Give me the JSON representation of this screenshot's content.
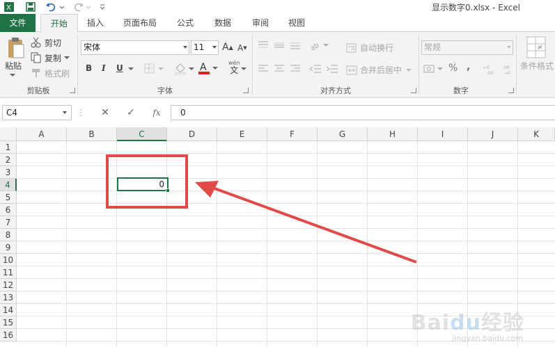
{
  "titlebar": {
    "title": "显示数字0.xlsx - Excel"
  },
  "tabs": [
    {
      "label": "文件"
    },
    {
      "label": "开始"
    },
    {
      "label": "插入"
    },
    {
      "label": "页面布局"
    },
    {
      "label": "公式"
    },
    {
      "label": "数据"
    },
    {
      "label": "审阅"
    },
    {
      "label": "视图"
    }
  ],
  "clipboard": {
    "paste": "粘贴",
    "cut": "剪切",
    "copy": "复制",
    "format_painter": "格式刷",
    "group": "剪贴板"
  },
  "font": {
    "name": "宋体",
    "size": "11",
    "bold": "B",
    "italic": "I",
    "underline": "U",
    "phonetic": "文",
    "phonetic_top": "wén",
    "grow": "A",
    "shrink": "A",
    "group": "字体"
  },
  "alignment": {
    "wrap": "自动换行",
    "merge": "合并后居中",
    "group": "对齐方式"
  },
  "number": {
    "format": "常规",
    "percent": "%",
    "comma": ",",
    "inc_dec": ".00",
    "dec_dec": ".00",
    "group": "数字"
  },
  "styles": {
    "conditional": "条件格式"
  },
  "formula_bar": {
    "name_box": "C4",
    "cancel": "✕",
    "enter": "✓",
    "fx": "fx",
    "value": "0"
  },
  "grid": {
    "columns": [
      "A",
      "B",
      "C",
      "D",
      "E",
      "F",
      "G",
      "H",
      "I",
      "J",
      "K"
    ],
    "rows": [
      "1",
      "2",
      "3",
      "4",
      "5",
      "6",
      "7",
      "8",
      "9",
      "10",
      "11",
      "12",
      "13",
      "14",
      "15",
      "16"
    ],
    "active_cell": {
      "ref": "C4",
      "value": "0"
    }
  },
  "colors": {
    "excel_green": "#217346",
    "annotation_red": "#e24a4a"
  },
  "watermark": {
    "text": "Baidu经验",
    "url": "jingyan.baidu.com"
  }
}
